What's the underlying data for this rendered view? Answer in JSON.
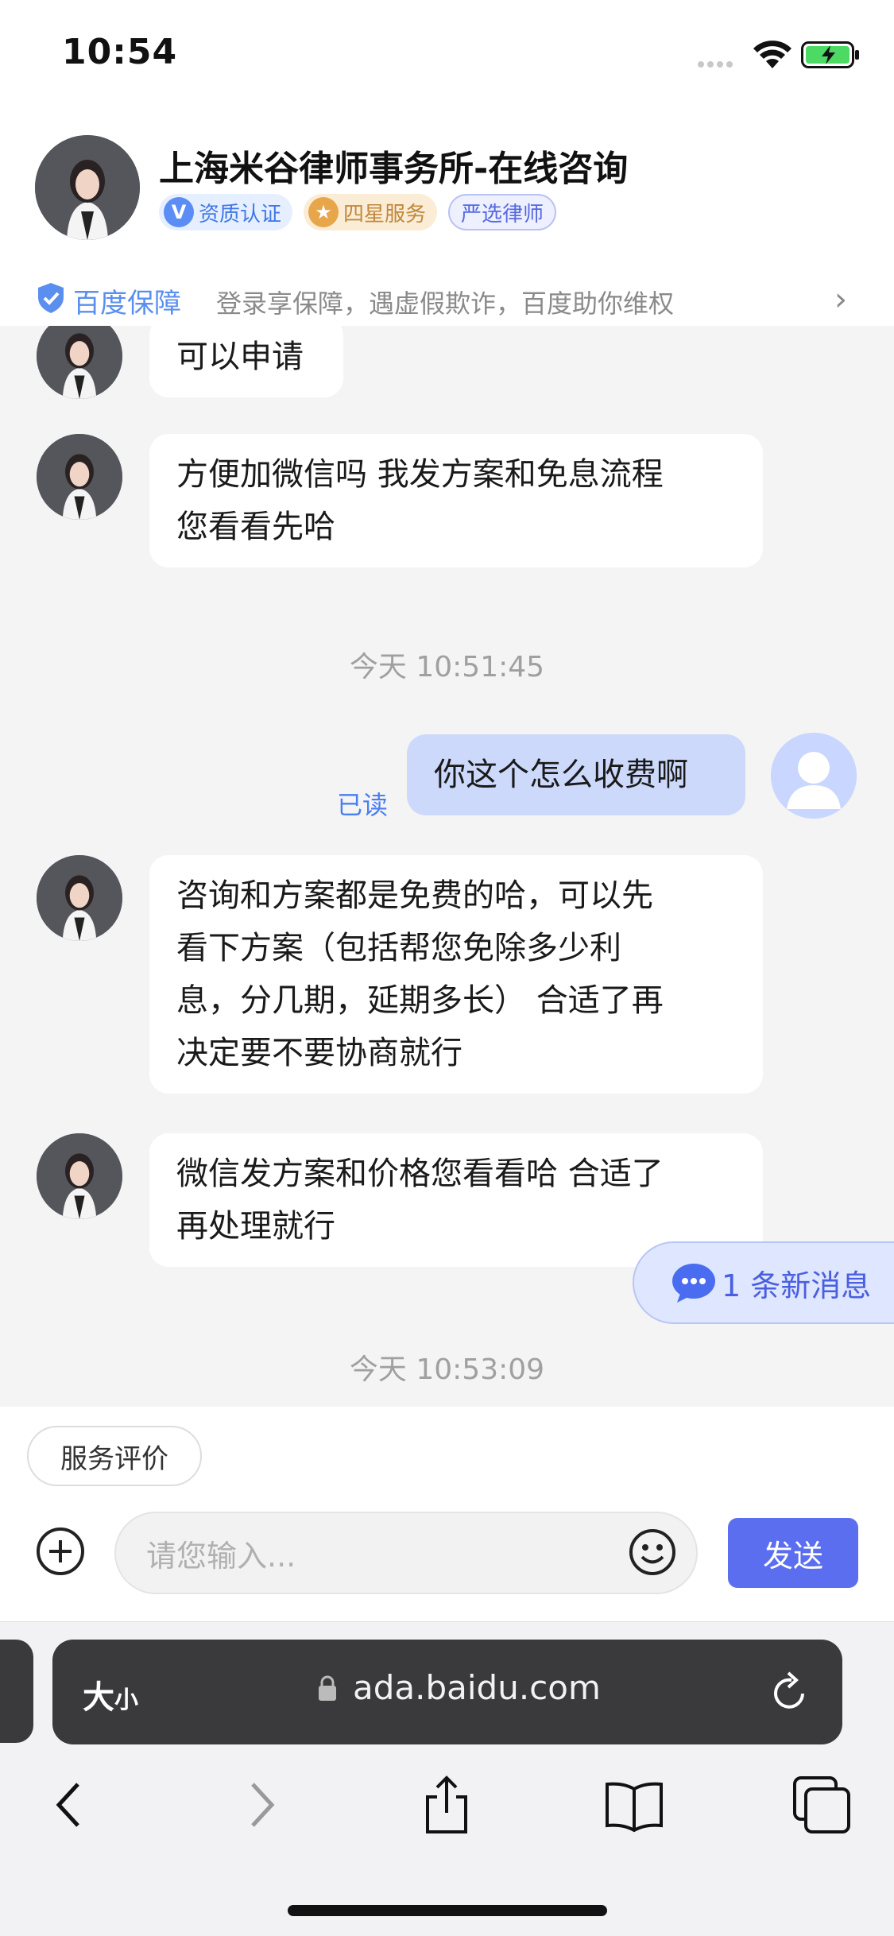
{
  "status": {
    "time": "10:54"
  },
  "header": {
    "title": "上海米谷律师事务所-在线咨询",
    "badges": {
      "certified": "资质认证",
      "four_star": "四星服务",
      "selected": "严选律师"
    },
    "guarantee": {
      "brand": "百度保障",
      "text": "登录享保障，遇虚假欺诈，百度助你维权",
      "arrow": "›"
    }
  },
  "chat": {
    "messages": [
      {
        "sender": "lawyer",
        "text": "可以申请"
      },
      {
        "sender": "lawyer",
        "lines": [
          "方便加微信吗 我发方案和免息流程",
          "您看看先哈"
        ]
      },
      {
        "type": "time",
        "text": "今天 10:51:45"
      },
      {
        "sender": "me",
        "text": "你这个怎么收费啊",
        "status": "已读"
      },
      {
        "sender": "lawyer",
        "lines": [
          "咨询和方案都是免费的哈，可以先",
          "看下方案（包括帮您免除多少利",
          "息，分几期，延期多长） 合适了再",
          "决定要不要协商就行"
        ]
      },
      {
        "sender": "lawyer",
        "lines": [
          "微信发方案和价格您看看哈 合适了",
          "再处理就行"
        ]
      },
      {
        "type": "time",
        "text": "今天 10:53:09"
      }
    ],
    "new_message_pill": "1 条新消息"
  },
  "input": {
    "rate_button": "服务评价",
    "placeholder": "请您输入...",
    "send_label": "发送"
  },
  "browser": {
    "font_size_big": "大",
    "font_size_small": "小",
    "url": "ada.baidu.com"
  },
  "colors": {
    "accent": "#5b6ef0",
    "my_bubble": "#cdd9fb",
    "guarantee_blue": "#5a8ff0"
  },
  "icons": [
    "wifi-icon",
    "battery-icon",
    "shield-icon",
    "chevron-right-icon",
    "plus-icon",
    "emoji-icon",
    "lock-icon",
    "reload-icon",
    "back-icon",
    "forward-icon",
    "share-icon",
    "bookmarks-icon",
    "tabs-icon"
  ]
}
